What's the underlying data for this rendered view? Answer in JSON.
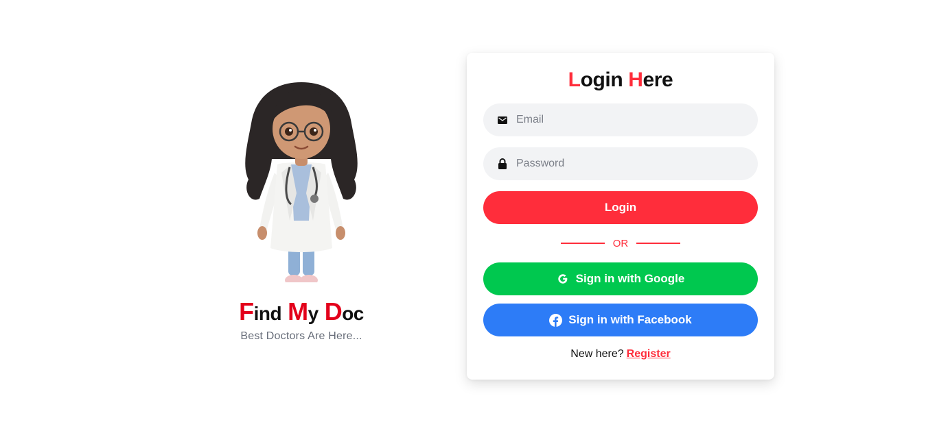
{
  "brand": {
    "title_parts": [
      {
        "cap": "F",
        "rest": "ind"
      },
      {
        "cap": "M",
        "rest": "y"
      },
      {
        "cap": "D",
        "rest": "oc"
      }
    ],
    "tagline": "Best Doctors Are Here..."
  },
  "login": {
    "title_parts": [
      {
        "cap": "L",
        "rest": "ogin"
      },
      {
        "cap": "H",
        "rest": "ere"
      }
    ],
    "email": {
      "placeholder": "Email",
      "value": "",
      "icon": "envelope-icon"
    },
    "password": {
      "placeholder": "Password",
      "value": "",
      "icon": "lock-icon"
    },
    "login_label": "Login",
    "divider_label": "OR",
    "google_label": "Sign in with Google",
    "facebook_label": "Sign in with Facebook",
    "register_prompt": "New here?",
    "register_link": "Register"
  },
  "colors": {
    "accent_red": "#ff2d3b",
    "brand_red": "#e3001b",
    "google_green": "#00c84f",
    "facebook_blue": "#2d7cf7",
    "field_bg": "#f2f3f5"
  }
}
